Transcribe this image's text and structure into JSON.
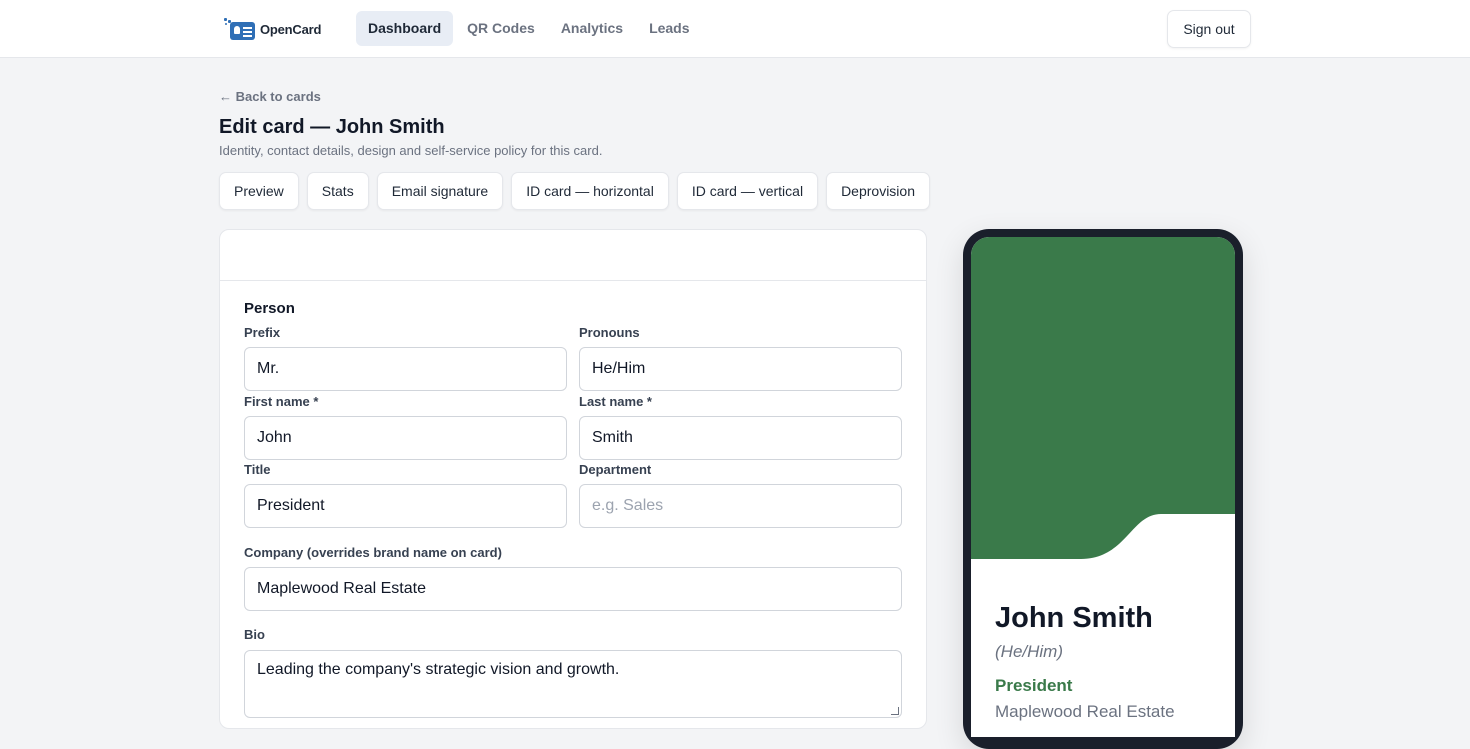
{
  "brand": {
    "name": "OpenCard",
    "accent": "#2f6fb6"
  },
  "nav": {
    "items": [
      {
        "label": "Dashboard",
        "active": true
      },
      {
        "label": "QR Codes",
        "active": false
      },
      {
        "label": "Analytics",
        "active": false
      },
      {
        "label": "Leads",
        "active": false
      }
    ],
    "signout_label": "Sign out"
  },
  "page": {
    "back_label": "← Back to cards",
    "title": "Edit card — John Smith",
    "subtitle": "Identity, contact details, design and self-service policy for this card."
  },
  "tabs": [
    "Preview",
    "Stats",
    "Email signature",
    "ID card — horizontal",
    "ID card — vertical",
    "Deprovision"
  ],
  "form": {
    "section_title": "Person",
    "prefix": {
      "label": "Prefix",
      "value": "Mr."
    },
    "pronouns": {
      "label": "Pronouns",
      "value": "He/Him"
    },
    "first_name": {
      "label": "First name *",
      "value": "John"
    },
    "last_name": {
      "label": "Last name *",
      "value": "Smith"
    },
    "title": {
      "label": "Title",
      "value": "President"
    },
    "department": {
      "label": "Department",
      "value": "",
      "placeholder": "e.g. Sales"
    },
    "company": {
      "label": "Company (overrides brand name on card)",
      "value": "Maplewood Real Estate"
    },
    "bio": {
      "label": "Bio",
      "value": "Leading the company's strategic vision and growth."
    }
  },
  "preview": {
    "name": "John Smith",
    "pronouns": "(He/Him)",
    "title": "President",
    "company": "Maplewood Real Estate",
    "theme_color": "#3a7a4a"
  }
}
